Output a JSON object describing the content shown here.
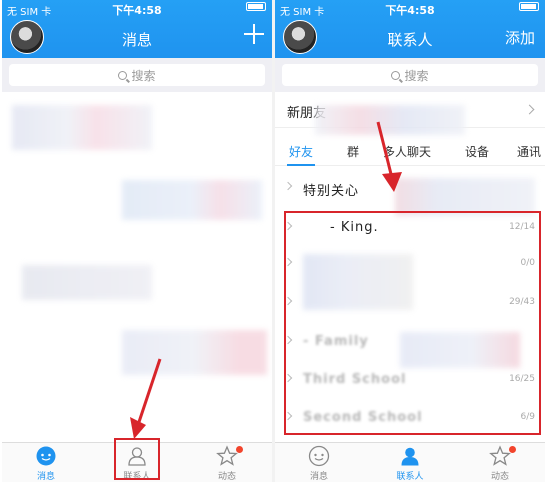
{
  "left_screen": {
    "status": {
      "carrier": "无 SIM 卡",
      "time": "下午4:58"
    },
    "title": "消息",
    "search_placeholder": "搜索",
    "tabs": [
      {
        "label": "消息",
        "icon": "message-icon",
        "active": true
      },
      {
        "label": "联系人",
        "icon": "contacts-icon",
        "active": false,
        "highlighted": true
      },
      {
        "label": "动态",
        "icon": "star-icon",
        "active": false,
        "badge": true
      }
    ]
  },
  "right_screen": {
    "status": {
      "carrier": "无 SIM 卡",
      "time": "下午4:58"
    },
    "title": "联系人",
    "action": "添加",
    "search_placeholder": "搜索",
    "new_friends": "新朋友",
    "segments": [
      "好友",
      "群",
      "多人聊天",
      "设备",
      "通讯"
    ],
    "special_group": "特别关心",
    "groups": [
      {
        "name": "- King.",
        "count": "12/14"
      },
      {
        "name": "",
        "count": "0/0"
      },
      {
        "name": "",
        "count": "29/43"
      },
      {
        "name": "- Family",
        "count": ""
      },
      {
        "name": "Third School",
        "count": "16/25"
      },
      {
        "name": "Second School",
        "count": "6/9"
      }
    ],
    "tabs": [
      {
        "label": "消息",
        "icon": "message-icon",
        "active": false
      },
      {
        "label": "联系人",
        "icon": "contacts-icon",
        "active": true
      },
      {
        "label": "动态",
        "icon": "star-icon",
        "active": false,
        "badge": true
      }
    ]
  },
  "colors": {
    "accent": "#1f93ef",
    "annotation": "#d8252b",
    "badge": "#f2442c"
  }
}
